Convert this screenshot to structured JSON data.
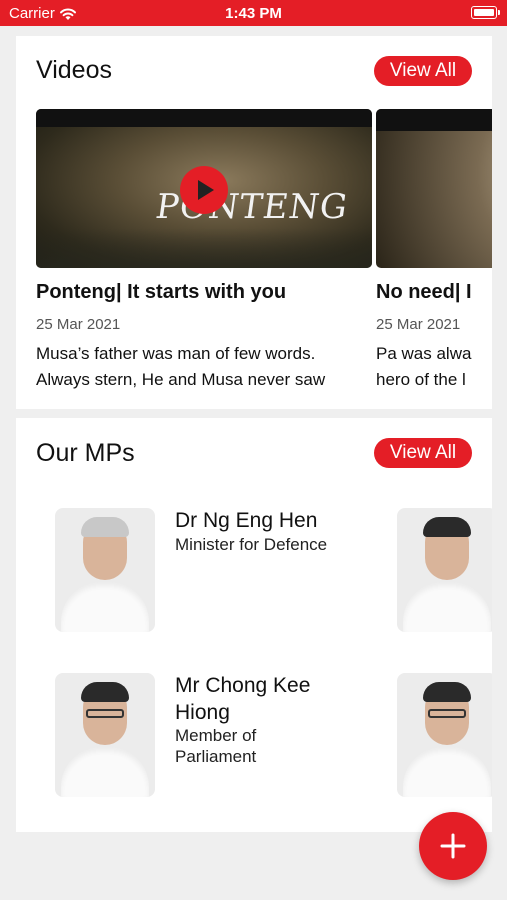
{
  "status_bar": {
    "carrier": "Carrier",
    "time": "1:43 PM"
  },
  "videos": {
    "title": "Videos",
    "view_all": "View All",
    "items": [
      {
        "thumb_text": "PONTENG",
        "title": "Ponteng| It starts with you",
        "date": "25 Mar 2021",
        "description": "Musa’s father was man of few words. Always stern, He and Musa never saw"
      },
      {
        "title": "No need| I",
        "date": "25 Mar 2021",
        "description": "Pa was alwa hero of the l"
      }
    ]
  },
  "mps": {
    "title": "Our MPs",
    "view_all": "View All",
    "items": [
      {
        "name": "Dr Ng Eng Hen",
        "role": "Minister for Defence"
      },
      {
        "name": "Mr Chong Kee Hiong",
        "role": "Member of Parliament"
      }
    ]
  },
  "colors": {
    "accent": "#e41e26",
    "background": "#efefef",
    "card": "#ffffff"
  },
  "icons": {
    "fab": "plus-icon",
    "wifi": "wifi-icon",
    "battery": "battery-icon",
    "play": "play-icon"
  }
}
